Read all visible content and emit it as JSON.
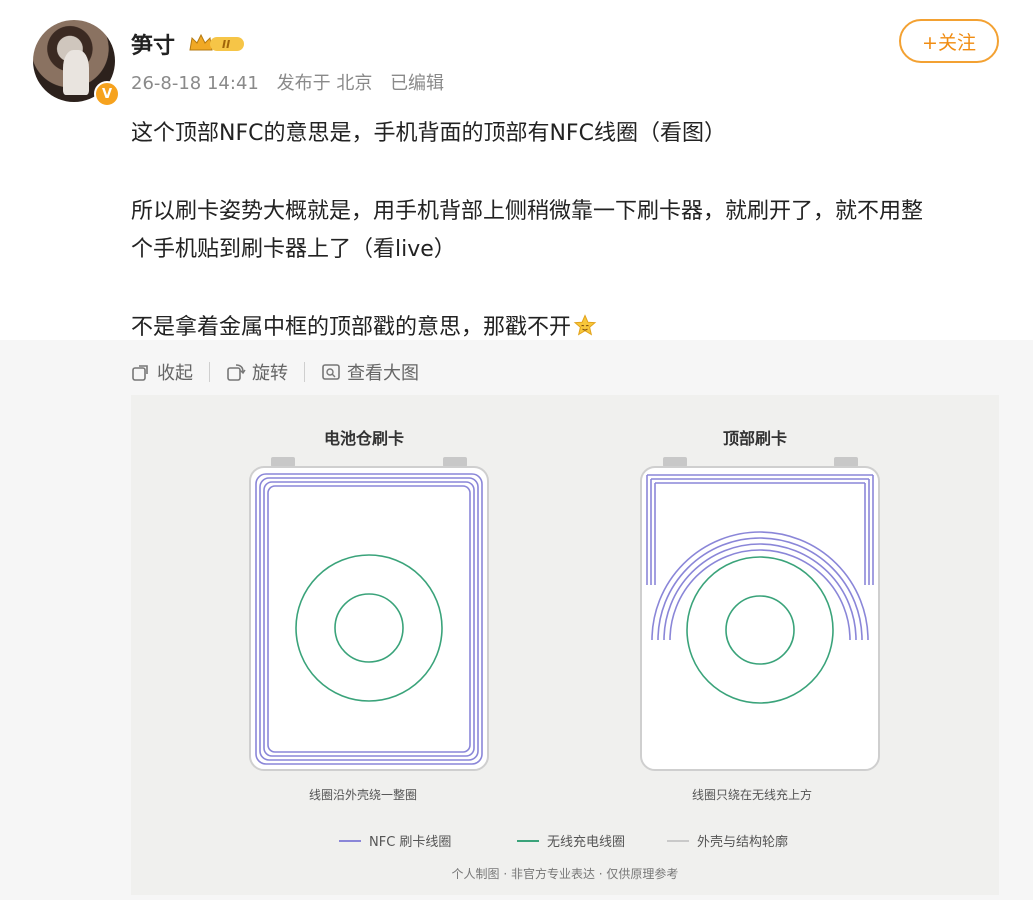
{
  "user": {
    "name": "笋寸",
    "level_badge": "II",
    "verified_mark": "V"
  },
  "meta": {
    "time": "26-8-18 14:41",
    "location": "发布于 北京",
    "edited": "已编辑"
  },
  "follow_label": "+关注",
  "post": {
    "line1": "这个顶部NFC的意思是，手机背面的顶部有NFC线圈（看图）",
    "line2": "所以刷卡姿势大概就是，用手机背部上侧稍微靠一下刷卡器，就刷开了，就不用整",
    "line3": "个手机贴到刷卡器上了（看live）",
    "line4": "不是拿着金属中框的顶部戳的意思，那戳不开",
    "emoji": "star-face-emoji"
  },
  "toolbar": {
    "collapse": "收起",
    "rotate": "旋转",
    "view_large": "查看大图"
  },
  "figure": {
    "left_title": "电池仓刷卡",
    "right_title": "顶部刷卡",
    "left_caption": "线圈沿外壳绕一整圈",
    "right_caption": "线圈只绕在无线充上方",
    "legend_nfc": "NFC 刷卡线圈",
    "legend_wireless": "无线充电线圈",
    "legend_outline": "外壳与结构轮廓",
    "footnote": "个人制图 · 非官方专业表达 · 仅供原理参考",
    "colors": {
      "nfc": "#8a86d8",
      "wireless": "#3aa37a",
      "outline": "#c9c9c9"
    }
  }
}
